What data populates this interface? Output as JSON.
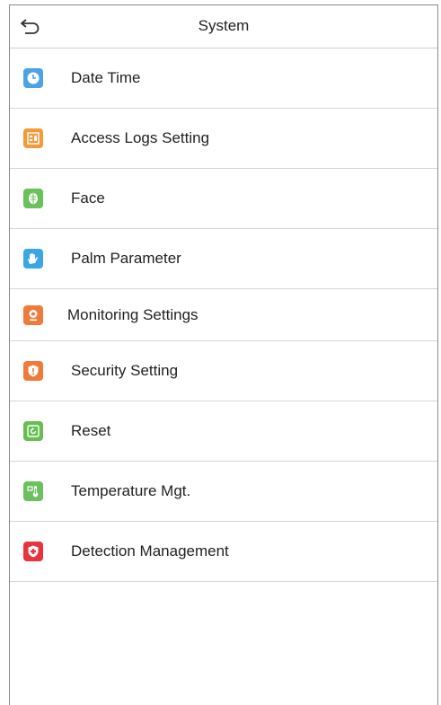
{
  "header": {
    "title": "System",
    "back_icon": "back-arrow-icon"
  },
  "menu": {
    "items": [
      {
        "label": "Date Time",
        "icon": "clock-icon",
        "color": "#4aa3e8"
      },
      {
        "label": "Access Logs Setting",
        "icon": "access-logs-icon",
        "color": "#f39a3a"
      },
      {
        "label": "Face",
        "icon": "face-icon",
        "color": "#69c257"
      },
      {
        "label": "Palm Parameter",
        "icon": "palm-icon",
        "color": "#3aa6e6"
      },
      {
        "label": "Monitoring Settings",
        "icon": "camera-icon",
        "color": "#f07a3a"
      },
      {
        "label": "Security Setting",
        "icon": "shield-icon",
        "color": "#f07a3a"
      },
      {
        "label": "Reset",
        "icon": "reset-icon",
        "color": "#66bf4f"
      },
      {
        "label": "Temperature Mgt.",
        "icon": "thermometer-icon",
        "color": "#6cc15f"
      },
      {
        "label": "Detection Management",
        "icon": "detection-shield-icon",
        "color": "#e8323c"
      }
    ]
  }
}
